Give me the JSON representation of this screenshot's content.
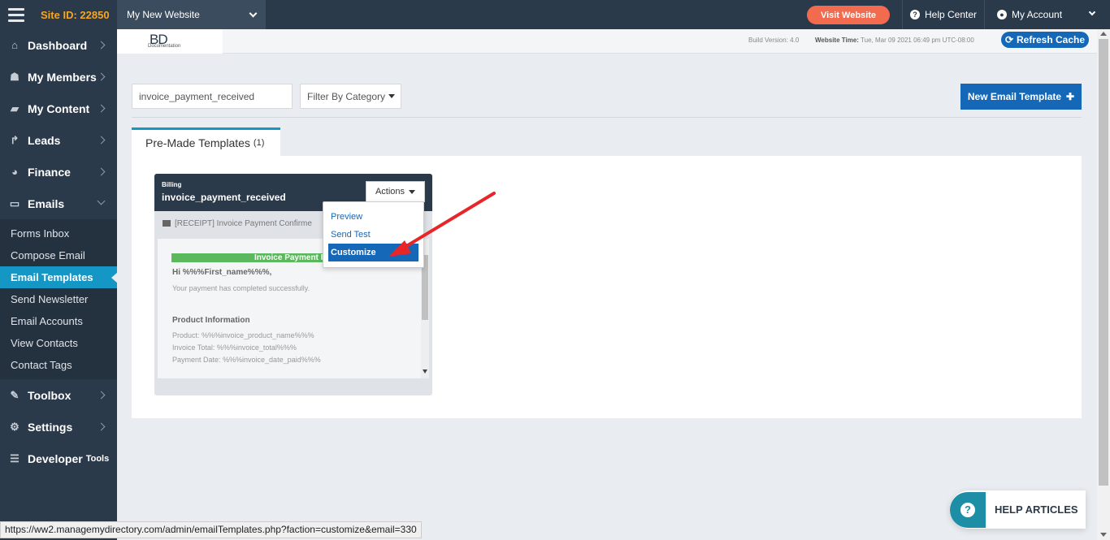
{
  "topbar": {
    "site_id": "Site ID: 22850",
    "website_select": "My New Website",
    "visit_website": "Visit Website",
    "help_center": "Help Center",
    "my_account": "My Account"
  },
  "header": {
    "logo_text": "BD",
    "logo_sub": "Documentation",
    "build_version": "Build Version: 4.0",
    "website_time_label": "Website Time:",
    "website_time_value": "Tue, Mar 09 2021 06:49 pm UTC-08:00",
    "refresh_cache": "Refresh Cache"
  },
  "sidebar": {
    "items": [
      {
        "label": "Dashboard",
        "icon": "home-icon"
      },
      {
        "label": "My Members",
        "icon": "users-icon"
      },
      {
        "label": "My Content",
        "icon": "folder-icon"
      },
      {
        "label": "Leads",
        "icon": "share-icon"
      },
      {
        "label": "Finance",
        "icon": "pie-chart-icon"
      },
      {
        "label": "Emails",
        "icon": "inbox-icon"
      }
    ],
    "email_subitems": [
      "Forms Inbox",
      "Compose Email",
      "Email Templates",
      "Send Newsletter",
      "Email Accounts",
      "View Contacts",
      "Contact Tags"
    ],
    "bottom_items": [
      {
        "label": "Toolbox",
        "icon": "wrench-icon"
      },
      {
        "label": "Settings",
        "icon": "gear-icon"
      },
      {
        "label": "Developer",
        "suffix": "Tools",
        "icon": "sliders-icon"
      }
    ]
  },
  "filters": {
    "search_value": "invoice_payment_received",
    "filter_category": "Filter By Category",
    "new_template": "New Email Template"
  },
  "tabs": {
    "premade_label": "Pre-Made Templates",
    "premade_count": "(1)"
  },
  "card": {
    "category": "Billing",
    "title": "invoice_payment_received",
    "actions": "Actions",
    "subject": "[RECEIPT] Invoice Payment Confirme",
    "preview": {
      "banner": "Invoice Payment Rec",
      "greeting": "Hi %%%First_name%%%,",
      "body": "Your payment has completed successfully.",
      "product_heading": "Product Information",
      "lines": [
        "Product: %%%invoice_product_name%%%",
        "Invoice Total: %%%invoice_total%%%",
        "Payment Date: %%%invoice_date_paid%%%"
      ]
    }
  },
  "dropdown": {
    "items": [
      "Preview",
      "Send Test",
      "Customize"
    ],
    "active": "Customize"
  },
  "status_url": "https://ww2.managemydirectory.com/admin/emailTemplates.php?faction=customize&email=330",
  "help_articles": "HELP ARTICLES",
  "colors": {
    "sidebar": "#2b3a4a",
    "accent": "#1597c5",
    "primary_button": "#1567b8",
    "visit_button": "#f26b4e",
    "site_id": "#f5a623",
    "arrow": "#e8262a"
  }
}
